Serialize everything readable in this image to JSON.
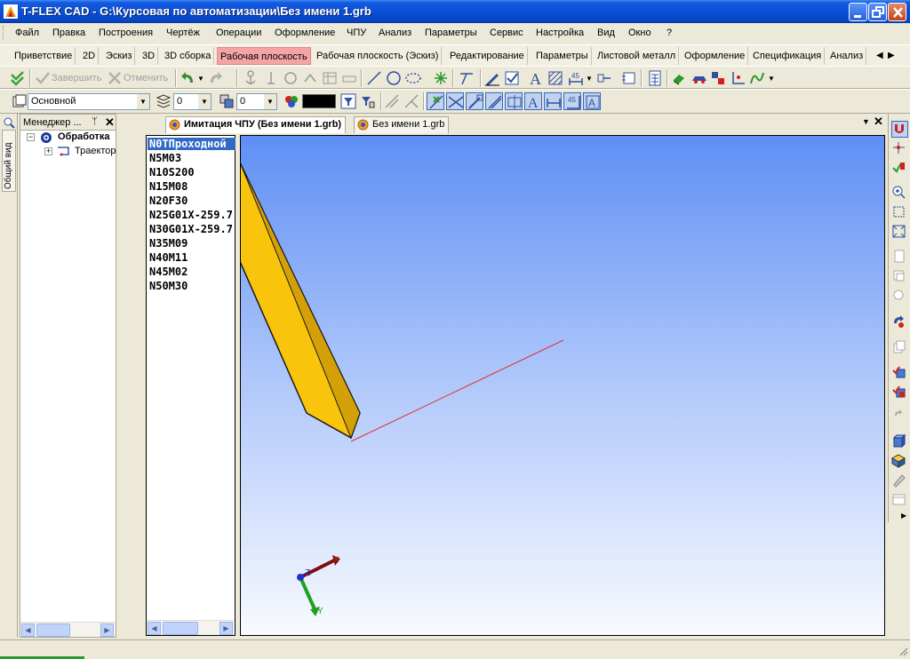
{
  "window": {
    "title": "T-FLEX CAD - G:\\Курсовая по автоматизации\\Без имени 1.grb"
  },
  "menu": [
    "Файл",
    "Правка",
    "Построения",
    "Чертёж",
    "Операции",
    "Оформление",
    "ЧПУ",
    "Анализ",
    "Параметры",
    "Сервис",
    "Настройка",
    "Вид",
    "Окно",
    "?"
  ],
  "ribbon_tabs": [
    "Приветствие",
    "2D",
    "Эскиз",
    "3D",
    "3D сборка",
    "Рабочая плоскость",
    "Рабочая плоскость (Эскиз)",
    "Редактирование",
    "Параметры",
    "Листовой металл",
    "Оформление",
    "Спецификация",
    "Анализ"
  ],
  "ribbon_active_index": 5,
  "toolbar": {
    "finish_label": "Завершить",
    "cancel_label": "Отменить"
  },
  "props_bar": {
    "layer": "Основной",
    "level_value": "0",
    "priority_value": "0"
  },
  "manager": {
    "title": "Менеджер ...",
    "pin": "ᛘ",
    "close": "✕",
    "side_tab": "Общий вид",
    "tree": [
      {
        "label": "Обработка",
        "bold": true
      },
      {
        "label": "Траектор",
        "bold": false
      }
    ]
  },
  "doc_tabs": [
    {
      "label": "Имитация ЧПУ (Без имени 1.grb)",
      "active": true
    },
    {
      "label": "Без имени 1.grb",
      "active": false
    }
  ],
  "nc_program": [
    "N0TПроходной",
    "N5M03",
    "N10S200",
    "N15M08",
    "N20F30",
    "N25G01X-259.7",
    "N30G01X-259.7",
    "N35M09",
    "N40M11",
    "N45M02",
    "N50M30"
  ],
  "axes": {
    "x": "X",
    "y": "Y",
    "z": "Z"
  },
  "colors": {
    "tool_body": "#f8c40c",
    "toolpath": "#e03030",
    "viewport_top": "#5f8ff5",
    "viewport_bottom": "#f8fafe",
    "ribbon_active": "#f4a4a4"
  }
}
